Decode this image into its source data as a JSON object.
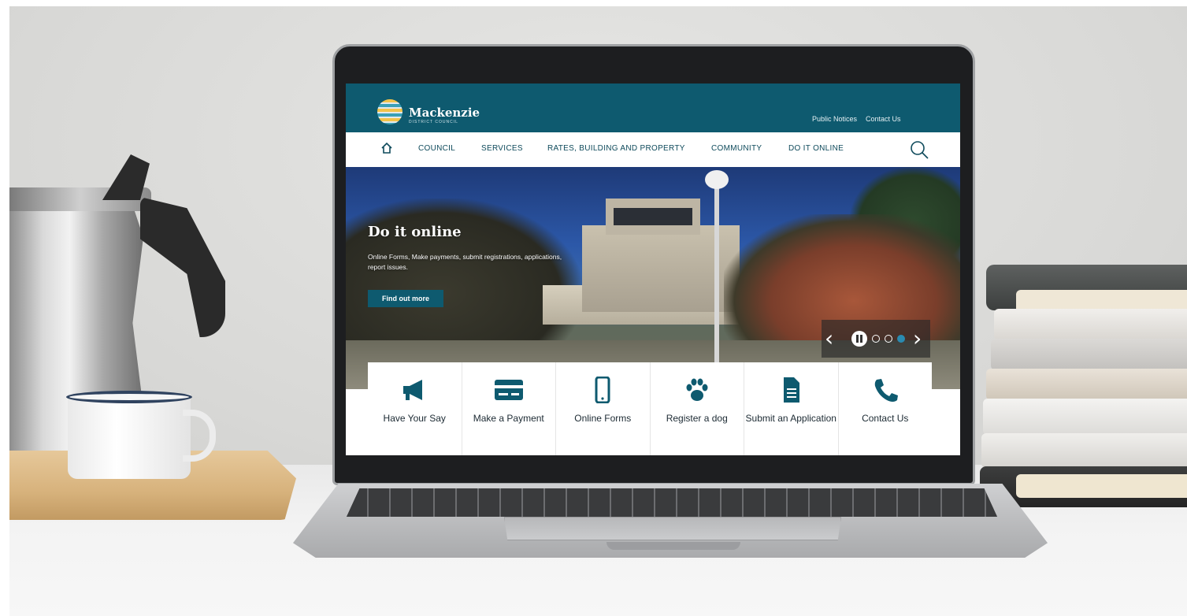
{
  "site": {
    "brand": "Mackenzie",
    "brand_sub": "DISTRICT COUNCIL",
    "colors": {
      "primary": "#0e5a6f",
      "accent": "#2a8ab0",
      "nav_text": "#0e4a5b"
    }
  },
  "utility_nav": {
    "public_notices": "Public Notices",
    "contact_us": "Contact Us"
  },
  "main_nav": {
    "home_icon": "home-icon",
    "items": [
      "COUNCIL",
      "SERVICES",
      "RATES, BUILDING AND PROPERTY",
      "COMMUNITY",
      "DO IT ONLINE"
    ],
    "search_icon": "search-icon"
  },
  "hero": {
    "title": "Do it online",
    "text": "Online Forms, Make payments, submit registrations, applications, report issues.",
    "button": "Find out more",
    "carousel": {
      "slides": 3,
      "active": 3
    }
  },
  "quick_links": [
    {
      "label": "Have Your Say",
      "icon": "megaphone-icon"
    },
    {
      "label": "Make a Payment",
      "icon": "card-icon"
    },
    {
      "label": "Online Forms",
      "icon": "mobile-icon"
    },
    {
      "label": "Register a dog",
      "icon": "paw-icon"
    },
    {
      "label": "Submit an Application",
      "icon": "document-icon"
    },
    {
      "label": "Contact Us",
      "icon": "phone-icon"
    }
  ]
}
